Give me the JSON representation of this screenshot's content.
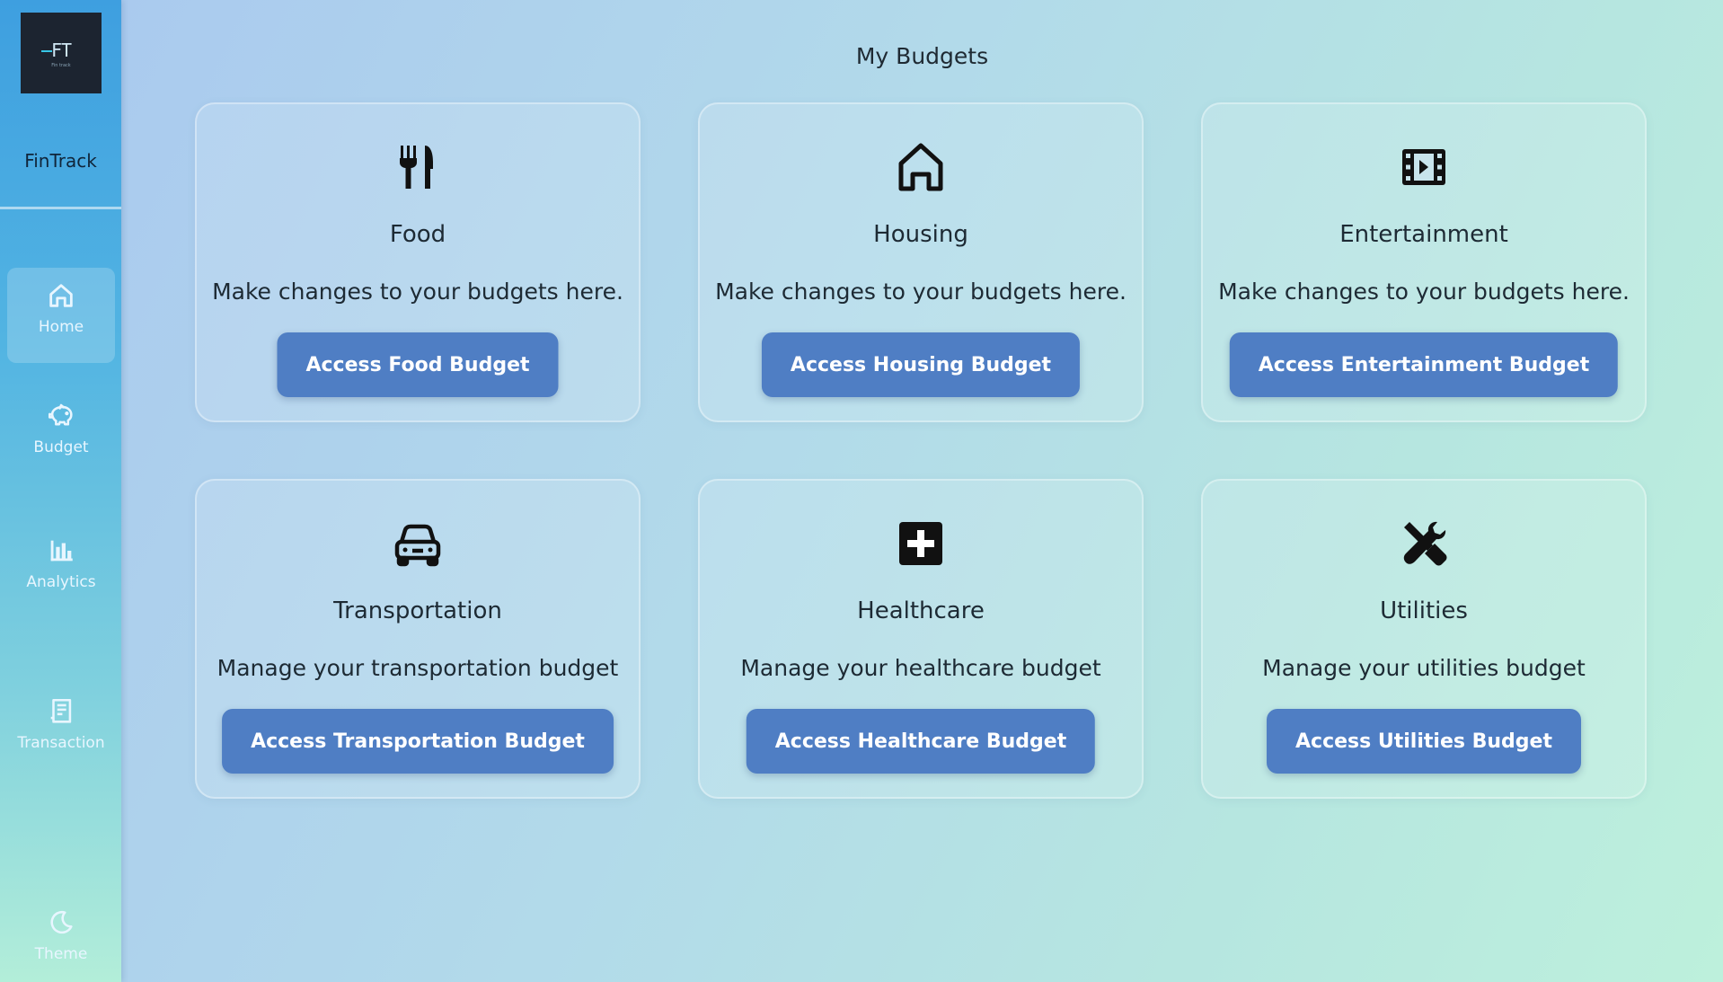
{
  "sidebar": {
    "logo": {
      "mark": "FT",
      "tagline": "Fin track"
    },
    "brand": "FinTrack",
    "nav": [
      {
        "label": "Home",
        "icon": "home-icon",
        "active": true
      },
      {
        "label": "Budget",
        "icon": "piggy-bank-icon"
      },
      {
        "label": "Analytics",
        "icon": "bar-chart-icon"
      },
      {
        "label": "Transaction",
        "icon": "receipt-icon"
      },
      {
        "label": "Theme",
        "icon": "moon-icon"
      }
    ]
  },
  "main": {
    "title": "My Budgets",
    "cards": [
      {
        "title": "Food",
        "icon": "fork-knife-icon",
        "description": "Make changes to your budgets here.",
        "button": "Access Food Budget"
      },
      {
        "title": "Housing",
        "icon": "house-icon",
        "description": "Make changes to your budgets here.",
        "button": "Access Housing Budget"
      },
      {
        "title": "Entertainment",
        "icon": "film-icon",
        "description": "Make changes to your budgets here.",
        "button": "Access Entertainment Budget"
      },
      {
        "title": "Transportation",
        "icon": "car-icon",
        "description": "Manage your transportation budget",
        "button": "Access Transportation Budget"
      },
      {
        "title": "Healthcare",
        "icon": "medical-cross-icon",
        "description": "Manage your healthcare budget",
        "button": "Access Healthcare Budget"
      },
      {
        "title": "Utilities",
        "icon": "tools-icon",
        "description": "Manage your utilities budget",
        "button": "Access Utilities Budget"
      }
    ]
  },
  "colors": {
    "button": "#4f7ec4",
    "sidebar_top": "#3e9fe0",
    "sidebar_bottom": "#b3eed9",
    "text": "#1d2a34"
  }
}
